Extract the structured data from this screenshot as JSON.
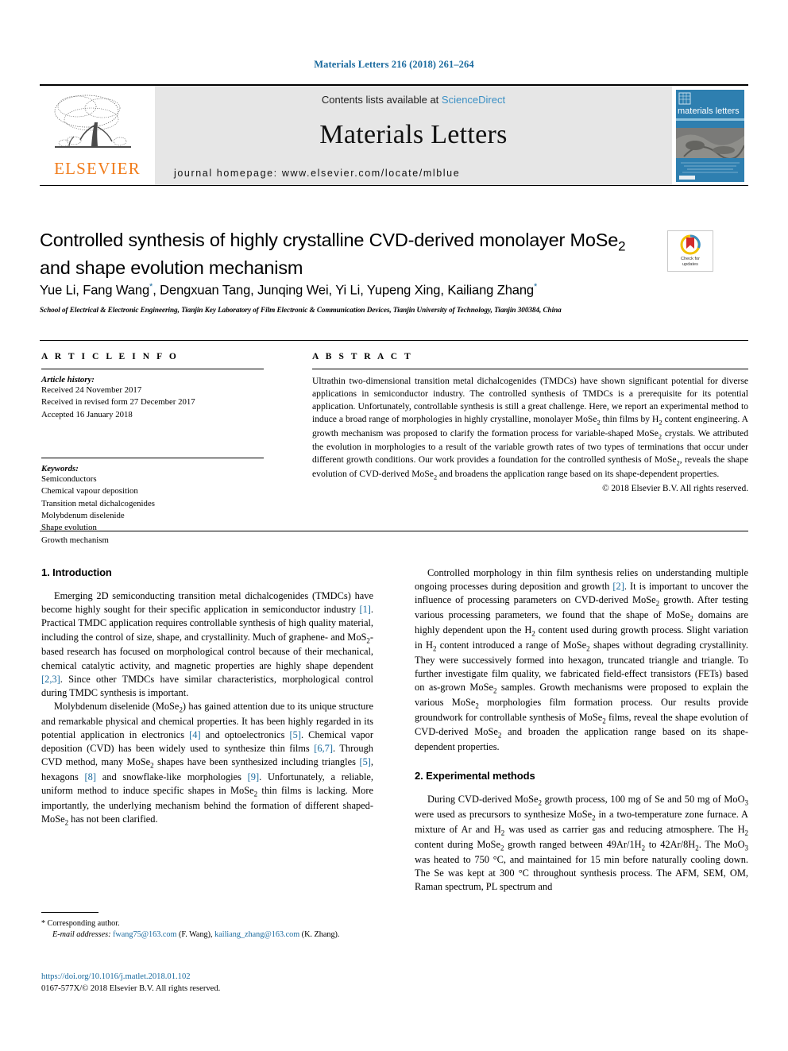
{
  "running_head": "Materials Letters 216 (2018) 261–264",
  "masthead": {
    "publisher_name": "ELSEVIER",
    "contents_prefix": "Contents lists available at ",
    "sciencedirect": "ScienceDirect",
    "journal_name": "Materials Letters",
    "homepage": "journal homepage: www.elsevier.com/locate/mlblue",
    "cover_title": "materials letters"
  },
  "article": {
    "title_line1": "Controlled synthesis of highly crystalline CVD-derived monolayer MoSe",
    "title_sub1": "2",
    "title_line2": "and shape evolution mechanism",
    "crossmark_label_1": "Check for",
    "crossmark_label_2": "updates",
    "authors": "Yue Li, Fang Wang*, Dengxuan Tang, Junqing Wei, Yi Li, Yupeng Xing, Kailiang Zhang*",
    "affiliation": "School of Electrical & Electronic Engineering, Tianjin Key Laboratory of Film Electronic & Communication Devices, Tianjin University of Technology, Tianjin 300384, China"
  },
  "info": {
    "heading": "A R T I C L E   I N F O",
    "history_label": "Article history:",
    "history": [
      "Received 24 November 2017",
      "Received in revised form 27 December 2017",
      "Accepted 16 January 2018"
    ],
    "keywords_label": "Keywords:",
    "keywords": [
      "Semiconductors",
      "Chemical vapour deposition",
      "Transition metal dichalcogenides",
      "Molybdenum diselenide",
      "Shape evolution",
      "Growth mechanism"
    ]
  },
  "abstract": {
    "heading": "A B S T R A C T",
    "copyright": "© 2018 Elsevier B.V. All rights reserved."
  },
  "sections": {
    "introduction_heading": "1. Introduction",
    "experimental_heading": "2. Experimental methods"
  },
  "footnote": {
    "corresponding": "Corresponding author.",
    "email_label": "E-mail addresses:",
    "email1": "fwang75@163.com",
    "email1_owner": "(F. Wang),",
    "email2": "kailiang_zhang@163.com",
    "email2_owner": "(K. Zhang)."
  },
  "doi": {
    "link": "https://doi.org/10.1016/j.matlet.2018.01.102",
    "issn_line": "0167-577X/© 2018 Elsevier B.V. All rights reserved."
  },
  "colors": {
    "link_blue": "#1a6a9e",
    "sciencedirect_blue": "#3a8fc4",
    "elsevier_orange": "#f07c1b",
    "banner_gray": "#e6e6e6"
  }
}
